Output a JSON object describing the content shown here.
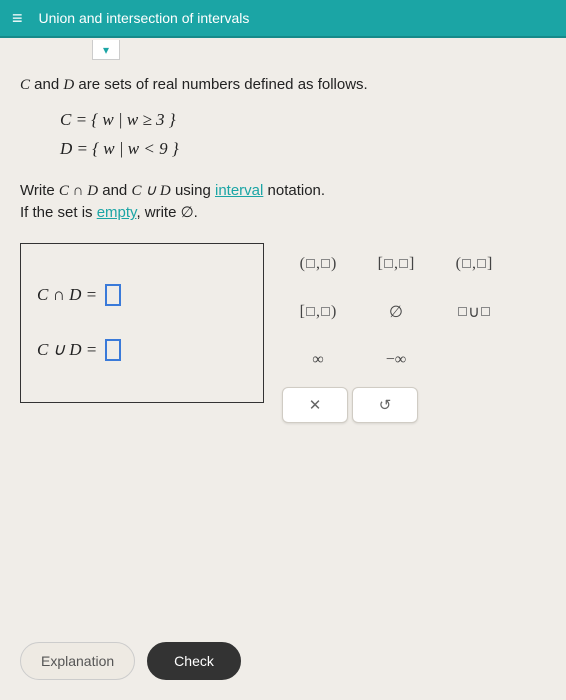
{
  "header": {
    "menu_glyph": "≡",
    "title": "Union and intersection of intervals"
  },
  "chevron_glyph": "▾",
  "intro": {
    "prefix": "",
    "c": "C",
    "and": " and ",
    "d": "D",
    "suffix": " are sets of real numbers defined as follows."
  },
  "definitions": {
    "c": "C = { w | w ≥ 3 }",
    "d": "D = { w | w < 9 }"
  },
  "instruction": {
    "line1_pre": "Write ",
    "cap": "C ∩ D",
    "line1_mid": " and ",
    "cup": "C ∪ D",
    "line1_post": " using ",
    "link_interval": "interval",
    "line1_end": " notation.",
    "line2_pre": "If the set is ",
    "link_empty": "empty",
    "line2_post": ", write ∅."
  },
  "answers": {
    "cap_label": "C ∩ D  =",
    "cup_label": "C ∪ D  =",
    "cap_value": "",
    "cup_value": ""
  },
  "palette": {
    "open_open": "(□,□)",
    "closed_closed": "[□,□]",
    "open_closed": "(□,□]",
    "closed_open": "[□,□)",
    "empty_set": "∅",
    "union_template": "□∪□",
    "infinity": "∞",
    "neg_infinity": "−∞"
  },
  "actions": {
    "clear": "✕",
    "undo": "↺"
  },
  "footer": {
    "explanation": "Explanation",
    "check": "Check"
  }
}
